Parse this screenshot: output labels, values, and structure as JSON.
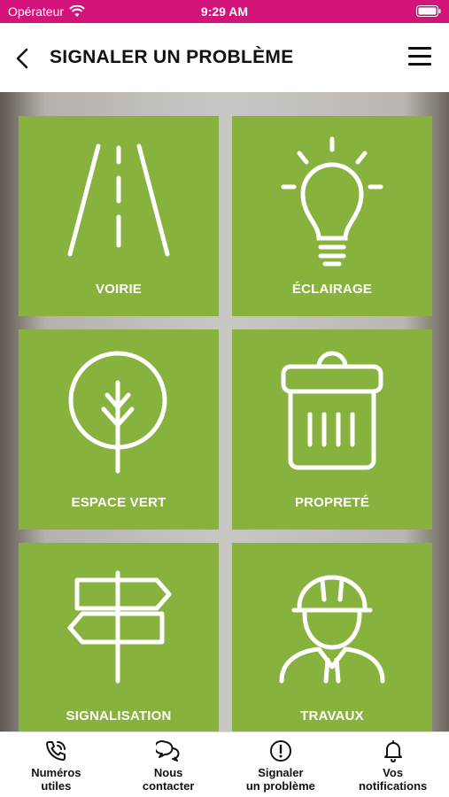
{
  "status_bar": {
    "carrier": "Opérateur",
    "time": "9:29 AM"
  },
  "header": {
    "title": "SIGNALER UN PROBLÈME"
  },
  "tiles": [
    {
      "label": "VOIRIE"
    },
    {
      "label": "ÉCLAIRAGE"
    },
    {
      "label": "ESPACE VERT"
    },
    {
      "label": "PROPRETÉ"
    },
    {
      "label": "SIGNALISATION"
    },
    {
      "label": "TRAVAUX"
    }
  ],
  "tabbar": {
    "items": [
      {
        "line1": "Numéros",
        "line2": "utiles",
        "icon": "phone-icon"
      },
      {
        "line1": "Nous",
        "line2": "contacter",
        "icon": "chat-icon"
      },
      {
        "line1": "Signaler",
        "line2": "un problème",
        "icon": "alert-icon"
      },
      {
        "line1": "Vos",
        "line2": "notifications",
        "icon": "bell-icon"
      }
    ]
  },
  "colors": {
    "status_bar": "#d1137a",
    "tile": "#87b23e"
  }
}
